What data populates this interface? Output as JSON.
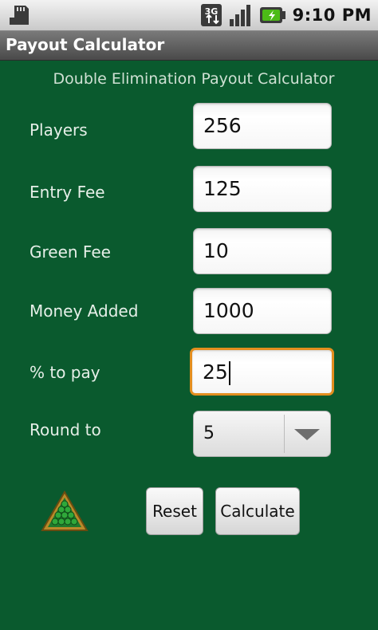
{
  "status_bar": {
    "time": "9:10 PM",
    "network_label": "3G"
  },
  "titlebar": {
    "title": "Payout Calculator"
  },
  "form": {
    "heading": "Double Elimination Payout Calculator",
    "players": {
      "label": "Players",
      "value": "256"
    },
    "entry_fee": {
      "label": "Entry Fee",
      "value": "125"
    },
    "green_fee": {
      "label": "Green Fee",
      "value": "10"
    },
    "money_added": {
      "label": "Money Added",
      "value": "1000"
    },
    "percent_to_pay": {
      "label": "% to pay",
      "value": "25"
    },
    "round_to": {
      "label": "Round to",
      "selected": "5"
    }
  },
  "buttons": {
    "reset": "Reset",
    "calculate": "Calculate"
  },
  "icons": {
    "sd_card": "sd-card-icon",
    "network": "3g-icon",
    "signal": "signal-icon",
    "battery": "battery-charging-icon",
    "rack": "billiard-rack-icon"
  },
  "colors": {
    "background": "#0a5a2e",
    "focus_border": "#e38e1f",
    "battery_fill": "#4cbb17"
  }
}
